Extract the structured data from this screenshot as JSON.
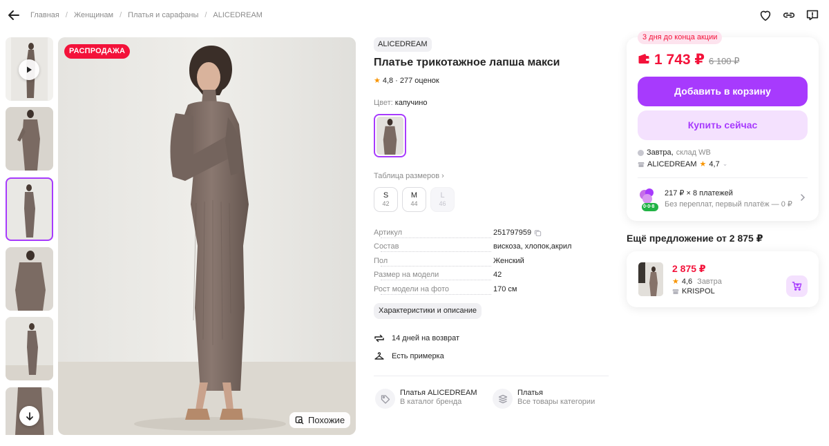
{
  "breadcrumbs": [
    "Главная",
    "Женщинам",
    "Платья и сарафаны",
    "ALICEDREAM"
  ],
  "header_icons": [
    "back-arrow-icon",
    "heart-icon",
    "link-icon",
    "report-icon"
  ],
  "gallery": {
    "thumbnail_count": 6,
    "active_index": 2,
    "sale_badge": "РАСПРОДАЖА",
    "similar_label": "Похожие"
  },
  "product": {
    "brand": "ALICEDREAM",
    "title": "Платье трикотажное лапша макси",
    "rating": "4,8",
    "reviews": "· 277 оценок",
    "color_label": "Цвет:",
    "color_value": "капучино",
    "size_table_label": "Таблица размеров",
    "sizes": [
      {
        "label": "S",
        "ru": "42",
        "available": true
      },
      {
        "label": "M",
        "ru": "44",
        "available": true
      },
      {
        "label": "L",
        "ru": "46",
        "available": false
      }
    ],
    "specs": [
      {
        "key": "Артикул",
        "value": "251797959"
      },
      {
        "key": "Состав",
        "value": "вискоза, хлопок,акрил"
      },
      {
        "key": "Пол",
        "value": "Женский"
      },
      {
        "key": "Размер на модели",
        "value": "42"
      },
      {
        "key": "Рост модели на фото",
        "value": "170 см"
      }
    ],
    "characteristics_button": "Характеристики и описание",
    "features": [
      {
        "icon": "return-arrows-icon",
        "text": "14 дней на возврат"
      },
      {
        "icon": "hanger-icon",
        "text": "Есть примерка"
      }
    ],
    "category_links": [
      {
        "icon": "tag-icon",
        "title": "Платья ALICEDREAM",
        "subtitle": "В каталог бренда"
      },
      {
        "icon": "layers-icon",
        "title": "Платья",
        "subtitle": "Все товары категории"
      }
    ]
  },
  "buy_box": {
    "promo_tag": "3 дня до конца акции",
    "price": "1 743 ₽",
    "old_price": "6 100 ₽",
    "add_to_cart": "Добавить в корзину",
    "buy_now": "Купить сейчас",
    "delivery_day": "Завтра,",
    "delivery_warehouse": "склад WB",
    "seller": "ALICEDREAM",
    "seller_rating": "4,7",
    "installments_title": "217 ₽ × 8 платежей",
    "installments_subtitle": "Без переплат, первый платёж — 0 ₽",
    "installments_badge": "0·0·8"
  },
  "another_offer": {
    "title": "Ещё предложение от 2 875 ₽",
    "price": "2 875 ₽",
    "rating": "4,6",
    "delivery": "Завтра",
    "seller": "KRISPOL"
  },
  "colors": {
    "accent": "#a73afd",
    "accent_light": "#f4e1fe",
    "price_red": "#f3123a",
    "star": "#f89400"
  }
}
